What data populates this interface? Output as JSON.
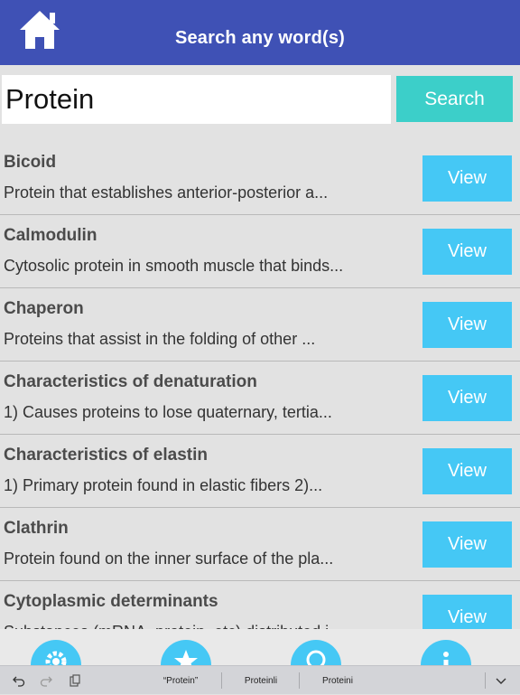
{
  "header": {
    "title": "Search any word(s)",
    "home_icon": "home-icon",
    "color": "#3f51b5"
  },
  "search": {
    "value": "Protein",
    "button_label": "Search",
    "button_color": "#3ccfc9"
  },
  "results": {
    "view_label": "View",
    "view_color": "#45c8f5",
    "items": [
      {
        "title": "Bicoid",
        "description": "Protein that establishes anterior-posterior a..."
      },
      {
        "title": "Calmodulin",
        "description": "Cytosolic protein in smooth muscle that binds..."
      },
      {
        "title": "Chaperon",
        "description": "Proteins that assist in the folding of other ..."
      },
      {
        "title": "Characteristics of denaturation",
        "description": "1) Causes proteins to lose quaternary, tertia..."
      },
      {
        "title": "Characteristics of elastin",
        "description": "1) Primary protein found in elastic fibers 2)..."
      },
      {
        "title": "Clathrin",
        "description": "Protein found on the inner surface of the pla..."
      },
      {
        "title": "Cytoplasmic determinants",
        "description": "Substances (mRNA, protein, etc) distributed i..."
      }
    ]
  },
  "tabbar": {
    "icons": [
      "gear-icon",
      "star-icon",
      "search-icon",
      "info-icon"
    ]
  },
  "keyboard_bar": {
    "icons": [
      "undo-icon",
      "redo-icon",
      "paste-icon",
      "chevron-down-icon"
    ],
    "suggestions": [
      "“Protein”",
      "Proteinli",
      "Proteini"
    ]
  }
}
